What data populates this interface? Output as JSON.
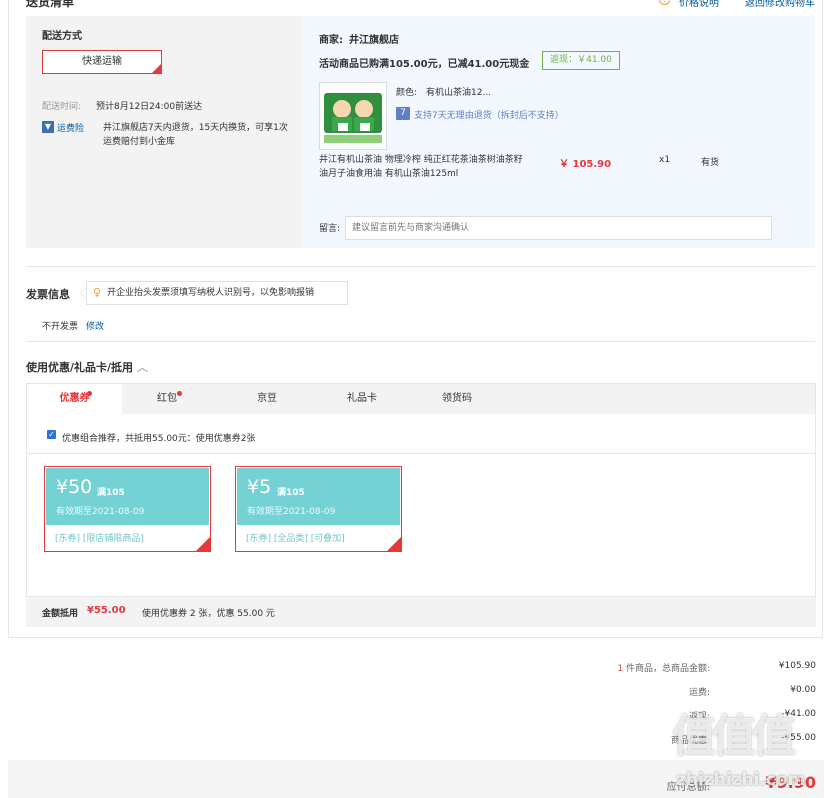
{
  "header": {
    "section_title": "送货清单",
    "price_note_link": "价格说明",
    "back_to_cart_link": "返回修改购物车"
  },
  "shipping": {
    "method_label": "配送方式",
    "method_value": "快递运输",
    "time_label": "配送时间:",
    "time_value": "预计8月12日24:00前送达",
    "insurance_badge": "运费险",
    "insurance_text": "井江旗舰店7天内退货，15天内换货，可享1次运费赔付到小金库"
  },
  "order": {
    "merchant_label": "商家:",
    "merchant_name": "井江旗舰店",
    "promo_text": "活动商品已购满105.00元，已减41.00元现金",
    "cashback_text": "返现：￥41.00",
    "color_label": "颜色:",
    "color_value": "有机山茶油12...",
    "return_policy": "支持7天无理由退货（拆封后不支持）",
    "product_name": "井江有机山茶油 物理冷榨 纯正红花茶油茶树油茶籽油月子油食用油 有机山茶油125ml",
    "price": "￥ 105.90",
    "quantity": "x1",
    "stock": "有货",
    "message_label": "留言:",
    "message_placeholder": "建议留言前先与商家沟通确认"
  },
  "invoice": {
    "title": "发票信息",
    "tip": "开企业抬头发票须填写纳税人识别号，以免影响报销",
    "status": "不开发票",
    "edit_link": "修改"
  },
  "coupons": {
    "section_title": "使用优惠/礼品卡/抵用",
    "tabs": [
      {
        "label": "优惠券"
      },
      {
        "label": "红包"
      },
      {
        "label": "京豆"
      },
      {
        "label": "礼品卡"
      },
      {
        "label": "领货码"
      }
    ],
    "combo_text": "优惠组合推荐，共抵用55.00元：使用优惠券2张",
    "items": [
      {
        "amount": "¥50",
        "condition": "满105",
        "expiry": "有效期至2021-08-09",
        "tags": "[东券] [限店铺限商品]"
      },
      {
        "amount": "¥5",
        "condition": "满105",
        "expiry": "有效期至2021-08-09",
        "tags": "[东券] [全品类] [可叠加]"
      }
    ],
    "summary_label": "金额抵用",
    "summary_amount": "¥55.00",
    "summary_detail": "使用优惠券 2 张，优惠 55.00 元"
  },
  "totals": {
    "count": "1",
    "count_label": "件商品，总商品金额:",
    "goods_total": "¥105.90",
    "shipping_label": "运费:",
    "shipping_value": "¥0.00",
    "cashback_label": "返现:",
    "cashback_value": "-¥41.00",
    "discount_label": "商品优惠:",
    "discount_value": "-¥55.00",
    "payable_label": "应付总额:",
    "payable_value": "¥9.90"
  },
  "watermark": {
    "glyphs": "值值值",
    "site": "zhizhizhi.com"
  }
}
